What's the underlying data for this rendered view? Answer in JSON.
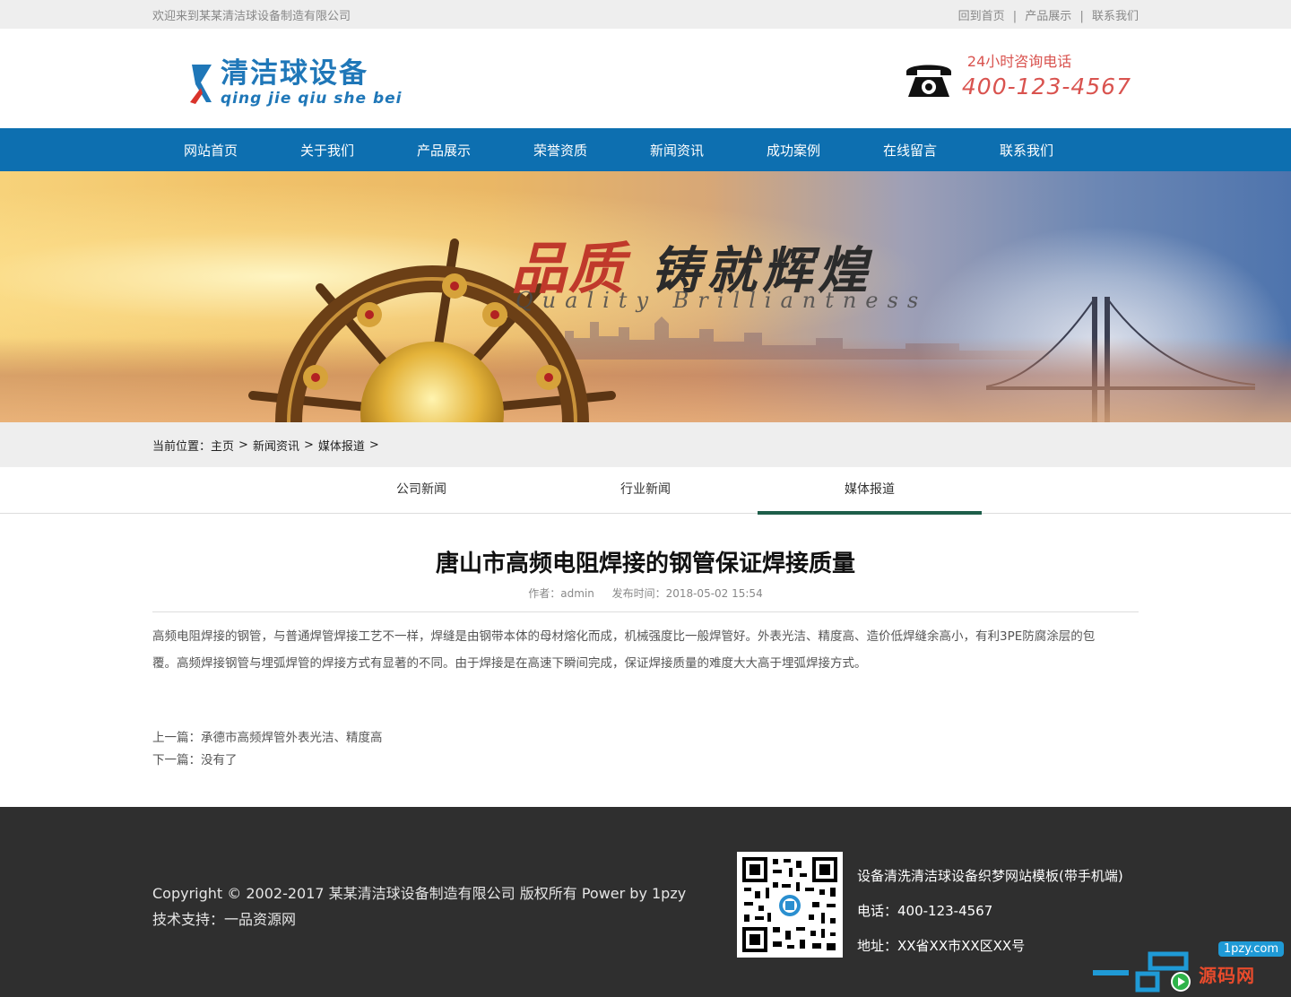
{
  "topbar": {
    "welcome": "欢迎来到某某清洁球设备制造有限公司",
    "links": [
      "回到首页",
      "产品展示",
      "联系我们"
    ],
    "separator": "|"
  },
  "header": {
    "logo_cn": "清洁球设备",
    "logo_pinyin": "qing jie qiu she bei",
    "phone_label": "24小时咨询电话",
    "phone_number": "400-123-4567"
  },
  "nav": {
    "items": [
      "网站首页",
      "关于我们",
      "产品展示",
      "荣誉资质",
      "新闻资讯",
      "成功案例",
      "在线留言",
      "联系我们"
    ]
  },
  "banner": {
    "title_red": "品质",
    "title_dark": "铸就辉煌",
    "subtitle": "Quality Brilliantness"
  },
  "breadcrumb": {
    "prefix": "当前位置：",
    "items": [
      "主页",
      "新闻资讯",
      "媒体报道"
    ],
    "separator": ">"
  },
  "tabs": {
    "items": [
      "公司新闻",
      "行业新闻",
      "媒体报道"
    ],
    "active_index": 2
  },
  "article": {
    "title": "唐山市高频电阻焊接的钢管保证焊接质量",
    "author": "作者：admin",
    "published": "发布时间：2018-05-02 15:54",
    "paragraph_line1": "高频电阻焊接的钢管，与普通焊管焊接工艺不一样，焊缝是由钢带本体的母材熔化而成，机械强度比一般焊管好。外表光洁、精度高、造价低焊缝余高小，有利3PE防腐涂层的包",
    "paragraph_line2": "覆。高频焊接钢管与埋弧焊管的焊接方式有显著的不同。由于焊接是在高速下瞬间完成，保证焊接质量的难度大大高于埋弧焊接方式。",
    "prev_label": "上一篇：",
    "prev_title": "承德市高频焊管外表光洁、精度高",
    "next_label": "下一篇：",
    "next_title": "没有了"
  },
  "footer": {
    "copyright": "Copyright © 2002-2017 某某清洁球设备制造有限公司 版权所有 Power by 1pzy",
    "support": "技术支持：一品资源网",
    "site_name": "设备清洗清洁球设备织梦网站模板(带手机端)",
    "phone": "电话：400-123-4567",
    "address": "地址：XX省XX市XX区XX号"
  },
  "watermark": {
    "url": "1pzy.com",
    "text": "源码网"
  },
  "colors": {
    "nav_blue": "#0d6fb0",
    "logo_blue": "#1f77b8",
    "phone_red": "#d9534f",
    "tab_active": "#1e5e4a",
    "footer_bg": "#2f2f2f",
    "topbar_bg": "#eeeeee"
  }
}
